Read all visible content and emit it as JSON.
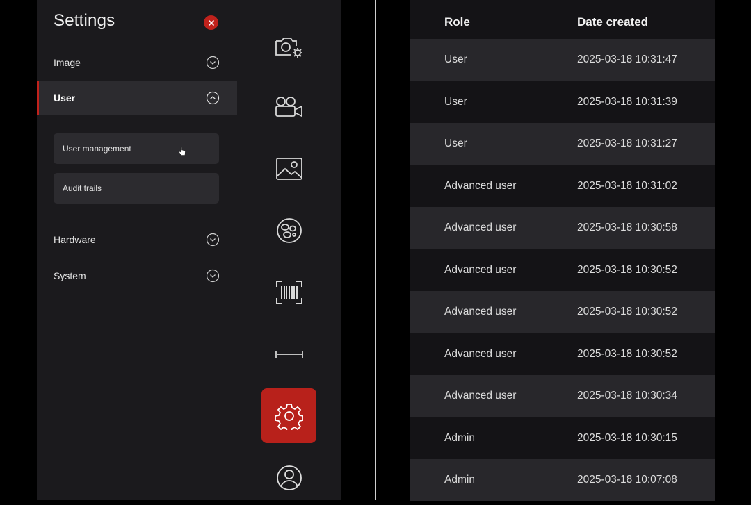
{
  "settings": {
    "title": "Settings",
    "sections": [
      {
        "label": "Image"
      },
      {
        "label": "User"
      },
      {
        "label": "Hardware"
      },
      {
        "label": "System"
      }
    ],
    "user_subitems": [
      {
        "label": "User management"
      },
      {
        "label": "Audit trails"
      }
    ]
  },
  "rail": {
    "icons": [
      "camera-settings-icon",
      "video-camera-icon",
      "image-icon",
      "cells-icon",
      "barcode-icon",
      "measure-icon",
      "settings-gear-icon",
      "user-profile-icon"
    ],
    "active": "settings-gear-icon"
  },
  "table": {
    "headers": {
      "role": "Role",
      "date": "Date created"
    },
    "rows": [
      {
        "role": "User",
        "date": "2025-03-18 10:31:47"
      },
      {
        "role": "User",
        "date": "2025-03-18 10:31:39"
      },
      {
        "role": "User",
        "date": "2025-03-18 10:31:27"
      },
      {
        "role": "Advanced user",
        "date": "2025-03-18 10:31:02"
      },
      {
        "role": "Advanced user",
        "date": "2025-03-18 10:30:58"
      },
      {
        "role": "Advanced user",
        "date": "2025-03-18 10:30:52"
      },
      {
        "role": "Advanced user",
        "date": "2025-03-18 10:30:52"
      },
      {
        "role": "Advanced user",
        "date": "2025-03-18 10:30:52"
      },
      {
        "role": "Advanced user",
        "date": "2025-03-18 10:30:34"
      },
      {
        "role": "Admin",
        "date": "2025-03-18 10:30:15"
      },
      {
        "role": "Admin",
        "date": "2025-03-18 10:07:08"
      }
    ]
  },
  "colors": {
    "accent": "#c0221c",
    "panel": "#1b1a1d",
    "row_alt": "#28272b"
  }
}
